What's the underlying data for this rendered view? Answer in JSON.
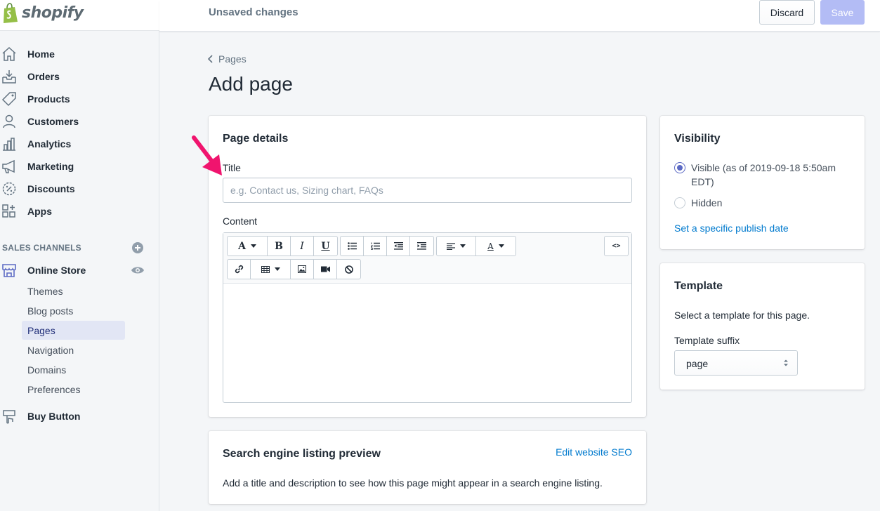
{
  "brand": {
    "name": "shopify"
  },
  "nav": {
    "items": [
      {
        "label": "Home",
        "icon": "home-icon"
      },
      {
        "label": "Orders",
        "icon": "orders-icon"
      },
      {
        "label": "Products",
        "icon": "tag-icon"
      },
      {
        "label": "Customers",
        "icon": "person-icon"
      },
      {
        "label": "Analytics",
        "icon": "bar-chart-icon"
      },
      {
        "label": "Marketing",
        "icon": "megaphone-icon"
      },
      {
        "label": "Discounts",
        "icon": "discount-icon"
      },
      {
        "label": "Apps",
        "icon": "apps-icon"
      }
    ],
    "sales_channels_heading": "SALES CHANNELS",
    "online_store": "Online Store",
    "sub_items": [
      "Themes",
      "Blog posts",
      "Pages",
      "Navigation",
      "Domains",
      "Preferences"
    ],
    "active_sub_item": "Pages",
    "buy_button": "Buy Button"
  },
  "topbar": {
    "status": "Unsaved changes",
    "discard_label": "Discard",
    "save_label": "Save"
  },
  "main": {
    "breadcrumb": "Pages",
    "title": "Add page",
    "page_details": {
      "heading": "Page details",
      "title_label": "Title",
      "title_placeholder": "e.g. Contact us, Sizing chart, FAQs",
      "title_value": "",
      "content_label": "Content"
    },
    "seo": {
      "heading": "Search engine listing preview",
      "edit_link": "Edit website SEO",
      "description": "Add a title and description to see how this page might appear in a search engine listing."
    },
    "visibility": {
      "heading": "Visibility",
      "visible_label_line1": "Visible (as of 2019-09-18 5:50am",
      "visible_label_line2": "EDT)",
      "hidden_label": "Hidden",
      "selected": "visible",
      "publish_link": "Set a specific publish date"
    },
    "template": {
      "heading": "Template",
      "description": "Select a template for this page.",
      "suffix_label": "Template suffix",
      "suffix_value": "page"
    }
  },
  "colors": {
    "accent": "#5c6ac4",
    "link": "#007ace",
    "save_disabled": "#b3bcf5",
    "annotation_arrow": "#f0146e"
  }
}
